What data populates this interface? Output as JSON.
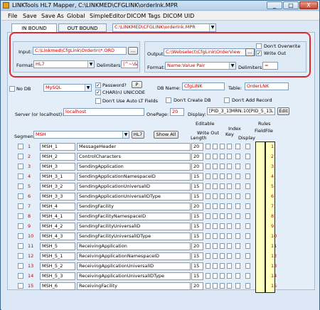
{
  "window": {
    "title": "LINKTools HL7 Mapper, C:\\LINKMED\\CFGLINK\\orderlnk.MPR",
    "min": "_",
    "max": "□",
    "close": "X"
  },
  "menu": [
    "File",
    "Save",
    "Save As",
    "Global",
    "SimpleEditor",
    "DICOM Tags",
    "DICOM UID"
  ],
  "tabs": {
    "inbound": "IN BOUND",
    "outbound": "OUT BOUND",
    "path": "C:\\LINKMED\\CFGLINK\\orderlnk.MPR"
  },
  "input": {
    "label": "Input:",
    "value": "C:\\Linkmed\\CfgLink\\OrderIn\\*.ORD",
    "browse": "...",
    "format_label": "Format:",
    "format": "HL7",
    "delim_label": "Delimiters:",
    "delim": "|^~\\&"
  },
  "output": {
    "label": "Output:",
    "value": "C:\\Webselect\\CfgLink\\OrderView",
    "browse": "...",
    "format_label": "Format:",
    "format": "Name:Value Pair",
    "delim_label": "Delimiters:",
    "delim": "="
  },
  "opts": {
    "dont_overwrite": "Don't Overwrite",
    "write_out": "Write Out"
  },
  "db": {
    "nodb": "No DB",
    "engine": "MySQL",
    "password": "Password?",
    "pbtn": "P",
    "charn": "CHAR(n) UNICODE",
    "dont_auto_lt": "Don't Use Auto LT Fields",
    "dbname_label": "DB Name:",
    "dbname": "CfgLINK",
    "table_label": "Table:",
    "table": "OrderLNK",
    "dont_create": "Don't Create DB",
    "dont_add": "Don't Add Record",
    "server_label": "Server (or localhost):",
    "server": "localhost",
    "onepage_label": "OnePage:",
    "onepage": "20",
    "display_label": "Display:",
    "display": "[PID_3_1]MRN:10[PID_5_1]L",
    "edit": "Edit"
  },
  "segment": {
    "label": "Segment:",
    "value": "MSH",
    "hl7": "HL7",
    "showall": "Show All"
  },
  "headers": {
    "editable": "Editable",
    "writeout": "Write Out",
    "length": "Length",
    "index": "Index",
    "key": "Key",
    "display": "Display",
    "rules": "Rules",
    "field": "Field",
    "file": "File"
  },
  "rows": [
    {
      "n": "1",
      "code": "MSH_1",
      "name": "MessageHeader",
      "len": "20"
    },
    {
      "n": "2",
      "code": "MSH_2",
      "name": "ControlCharacters",
      "len": "20"
    },
    {
      "n": "3",
      "code": "MSH_3",
      "name": "SendingApplication",
      "len": "20"
    },
    {
      "n": "4",
      "code": "MSH_3_1",
      "name": "SendingApplicationNamespaceID",
      "len": "15"
    },
    {
      "n": "5",
      "code": "MSH_3_2",
      "name": "SendingApplicationUniversalID",
      "len": "15"
    },
    {
      "n": "6",
      "code": "MSH_3_3",
      "name": "SendingApplicationUniversalIDType",
      "len": "15"
    },
    {
      "n": "7",
      "code": "MSH_4",
      "name": "SendingFacility",
      "len": "20"
    },
    {
      "n": "8",
      "code": "MSH_4_1",
      "name": "SendingFacilityNamespaceID",
      "len": "15"
    },
    {
      "n": "9",
      "code": "MSH_4_2",
      "name": "SendingFacilityUniversalID",
      "len": "15"
    },
    {
      "n": "10",
      "code": "MSH_4_3",
      "name": "SendingFacilityUniversalIDType",
      "len": "15"
    },
    {
      "n": "11",
      "code": "MSH_5",
      "name": "ReceivingApplication",
      "len": "20"
    },
    {
      "n": "12",
      "code": "MSH_5_1",
      "name": "ReceivingApplicationNamespaceID",
      "len": "15"
    },
    {
      "n": "13",
      "code": "MSH_5_2",
      "name": "ReceivingApplicationUniversalID",
      "len": "15"
    },
    {
      "n": "14",
      "code": "MSH_5_3",
      "name": "ReceivingApplicationUniversalIDType",
      "len": "15"
    },
    {
      "n": "15",
      "code": "MSH_6",
      "name": "ReceivingFacility",
      "len": "20"
    }
  ]
}
